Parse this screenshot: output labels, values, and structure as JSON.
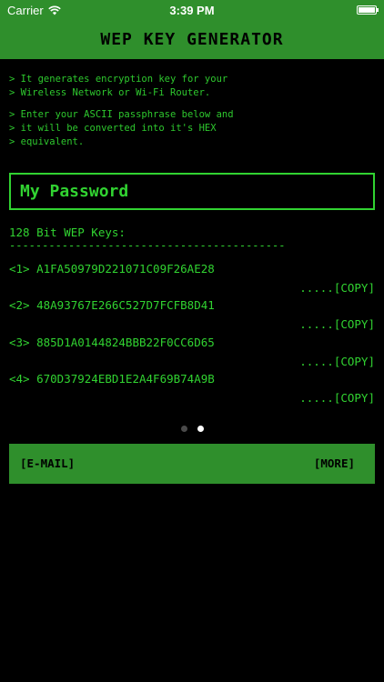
{
  "status_bar": {
    "carrier": "Carrier",
    "time": "3:39 PM",
    "wifi_icon": "wifi-icon",
    "battery_icon": "battery-icon"
  },
  "header": {
    "title": "WEP KEY GENERATOR"
  },
  "intro": {
    "paragraph1": [
      "> It generates encryption key for your",
      "> Wireless Network or Wi-Fi Router."
    ],
    "paragraph2": [
      "> Enter your ASCII passphrase below and",
      "> it will be converted into it's HEX",
      "> equivalent."
    ]
  },
  "password": {
    "value": "My Password"
  },
  "keys": {
    "heading": "128 Bit WEP Keys:",
    "divider": "--------------------------------------------------",
    "copy_label": ".....[COPY]",
    "items": [
      {
        "text": "<1> A1FA50979D221071C09F26AE28"
      },
      {
        "text": "<2> 48A93767E266C527D7FCFB8D41"
      },
      {
        "text": "<3> 885D1A0144824BBB22F0CC6D65"
      },
      {
        "text": "<4> 670D37924EBD1E2A4F69B74A9B"
      }
    ]
  },
  "pager": {
    "count": 2,
    "active_index": 1
  },
  "bottom_bar": {
    "email_label": "[E-MAIL]",
    "more_label": "[MORE]"
  },
  "colors": {
    "accent_green": "#2f8f2c",
    "text_green": "#31d331",
    "background": "#000000"
  }
}
